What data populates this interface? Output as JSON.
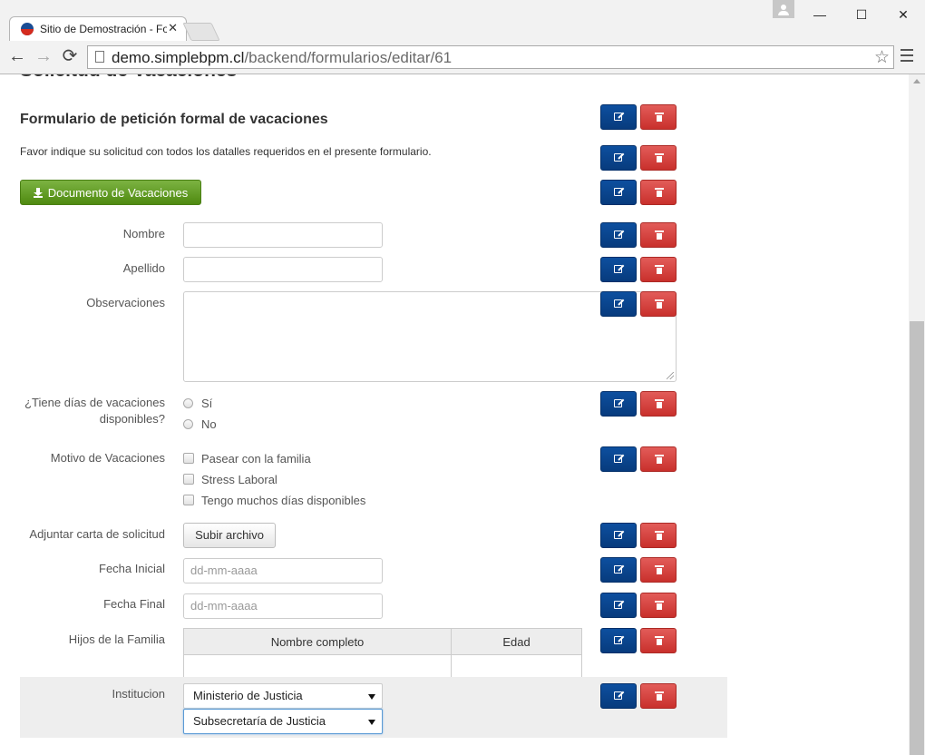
{
  "browser": {
    "tab_title": "Sitio de Demostración - Formularios",
    "tab_close": "✕",
    "url_host": "demo.simplebpm.cl",
    "url_path": "/backend/formularios/editar/61",
    "back_icon": "←",
    "forward_icon": "→",
    "reload_icon": "⟳",
    "star_icon": "☆",
    "minimize": "—",
    "maximize": "☐",
    "close": "✕"
  },
  "page": {
    "heading": "Solicitud de Vacaciones",
    "form_title": "Formulario de petición formal de vacaciones",
    "form_description": "Favor indique su solicitud con todos los datalles requeridos en el presente formulario.",
    "document_button": "Documento de Vacaciones"
  },
  "fields": {
    "nombre_label": "Nombre",
    "apellido_label": "Apellido",
    "observaciones_label": "Observaciones",
    "vacaciones_label": "¿Tiene días de vacaciones disponibles?",
    "radio_yes": "Sí",
    "radio_no": "No",
    "motivo_label": "Motivo de Vacaciones",
    "check_1": "Pasear con la familia",
    "check_2": "Stress Laboral",
    "check_3": "Tengo muchos días disponibles",
    "adjuntar_label": "Adjuntar carta de solicitud",
    "upload_button": "Subir archivo",
    "fecha_inicial_label": "Fecha Inicial",
    "fecha_final_label": "Fecha Final",
    "date_placeholder": "dd-mm-aaaa",
    "hijos_label": "Hijos de la Familia",
    "table_headers": [
      "Nombre completo",
      "Edad"
    ],
    "institucion_label": "Institucion",
    "select_1_value": "Ministerio de Justicia",
    "select_2_value": "Subsecretaría de Justicia"
  },
  "colors": {
    "edit_button": "#073b7d",
    "delete_button": "#c9302c",
    "document_button": "#5a9a18"
  },
  "icons": {
    "edit": "edit-icon",
    "delete": "trash-icon",
    "download": "download-icon"
  }
}
